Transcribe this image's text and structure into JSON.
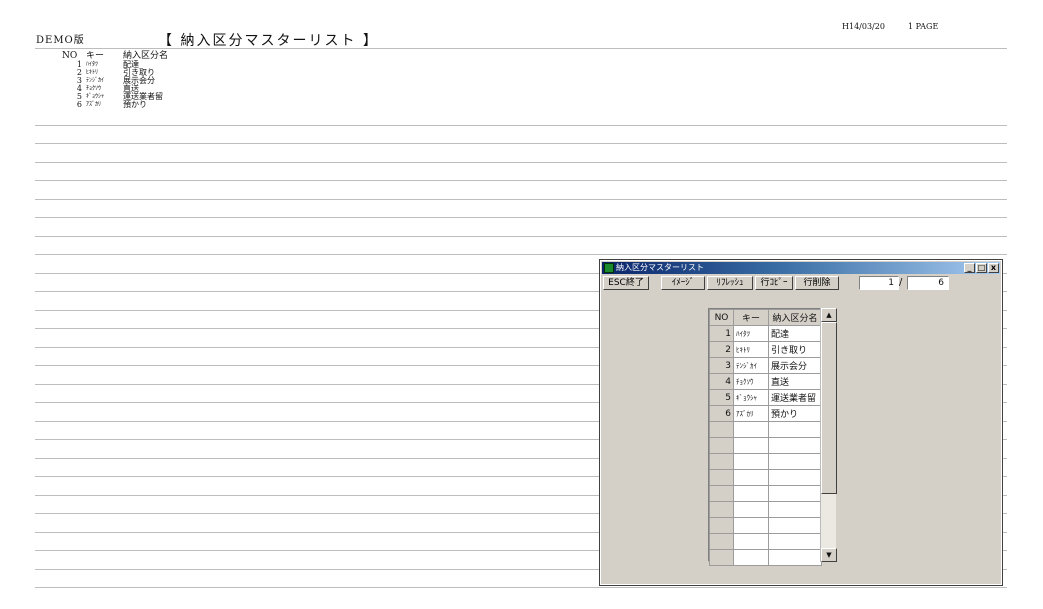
{
  "report": {
    "demo_label": "DEMO版",
    "title": "【 納入区分マスターリスト 】",
    "date": "H14/03/20",
    "page": "1 PAGE",
    "headers": {
      "no": "NO",
      "key": "キー",
      "name": "納入区分名"
    },
    "rows": [
      {
        "no": "1",
        "key": "ﾊｲﾀﾂ",
        "name": "配達"
      },
      {
        "no": "2",
        "key": "ﾋｷﾄﾘ",
        "name": "引き取り"
      },
      {
        "no": "3",
        "key": "ﾃﾝｼﾞｶｲ",
        "name": "展示会分"
      },
      {
        "no": "4",
        "key": "ﾁｮｸｿｳ",
        "name": "直送"
      },
      {
        "no": "5",
        "key": "ｷﾞｮｳｼｬ",
        "name": "運送業者留"
      },
      {
        "no": "6",
        "key": "ｱｽﾞｶﾘ",
        "name": "預かり"
      }
    ]
  },
  "window": {
    "title": "納入区分マスターリスト",
    "controls": {
      "minimize": "_",
      "maximize": "□",
      "close": "x"
    },
    "toolbar": {
      "esc_label": "ESC終了",
      "image_label": "ｲﾒｰｼﾞ",
      "refresh_label": "ﾘﾌﾚｯｼｭ",
      "copy_row_label": "行ｺﾋﾟｰ",
      "delete_row_label": "行削除"
    },
    "pager": {
      "current": "1",
      "total": "6",
      "separator": "/"
    },
    "grid": {
      "headers": {
        "no": "NO",
        "key": "キー",
        "name": "納入区分名"
      },
      "rows": [
        {
          "no": "1",
          "key": "ﾊｲﾀﾂ",
          "name": "配達"
        },
        {
          "no": "2",
          "key": "ﾋｷﾄﾘ",
          "name": "引き取り"
        },
        {
          "no": "3",
          "key": "ﾃﾝｼﾞｶｲ",
          "name": "展示会分"
        },
        {
          "no": "4",
          "key": "ﾁｮｸｿｳ",
          "name": "直送"
        },
        {
          "no": "5",
          "key": "ｷﾞｮｳｼｬ",
          "name": "運送業者留"
        },
        {
          "no": "6",
          "key": "ｱｽﾞｶﾘ",
          "name": "預かり"
        }
      ],
      "scroll_up": "▲",
      "scroll_down": "▼"
    }
  }
}
